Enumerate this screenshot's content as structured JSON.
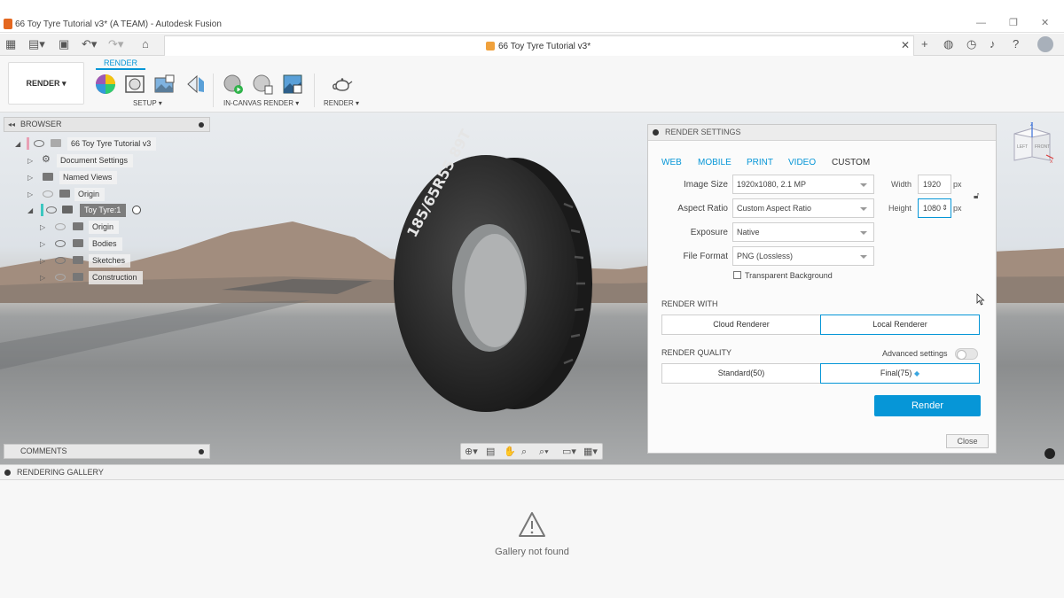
{
  "window": {
    "title": "66 Toy Tyre Tutorial v3* (A TEAM) - Autodesk Fusion",
    "minimize_icon": "minimize-icon",
    "maximize_icon": "maximize-icon",
    "close_icon": "close-icon"
  },
  "document_tab": {
    "label": "66 Toy Tyre Tutorial v3*"
  },
  "ribbon": {
    "workspace": "RENDER",
    "active_tab": "RENDER",
    "groups": {
      "setup": "SETUP",
      "in_canvas": "IN-CANVAS RENDER",
      "render": "RENDER"
    }
  },
  "browser": {
    "title": "BROWSER",
    "items": [
      {
        "label": "66 Toy Tyre Tutorial v3"
      },
      {
        "label": "Document Settings"
      },
      {
        "label": "Named Views"
      },
      {
        "label": "Origin"
      },
      {
        "label": "Toy Tyre:1"
      },
      {
        "label": "Origin"
      },
      {
        "label": "Bodies"
      },
      {
        "label": "Sketches"
      },
      {
        "label": "Construction"
      }
    ]
  },
  "tyre_text": "185/65R55 89T",
  "comments": {
    "title": "COMMENTS"
  },
  "render_settings": {
    "title": "RENDER SETTINGS",
    "presets": [
      "WEB",
      "MOBILE",
      "PRINT",
      "VIDEO",
      "CUSTOM"
    ],
    "active_preset": "CUSTOM",
    "image_size": {
      "label": "Image Size",
      "value": "1920x1080, 2.1 MP"
    },
    "aspect_ratio": {
      "label": "Aspect Ratio",
      "value": "Custom Aspect Ratio"
    },
    "exposure": {
      "label": "Exposure",
      "value": "Native"
    },
    "file_format": {
      "label": "File Format",
      "value": "PNG (Lossless)"
    },
    "transparent_bg": {
      "label": "Transparent Background",
      "checked": false
    },
    "width": {
      "label": "Width",
      "value": "1920",
      "unit": "px"
    },
    "height": {
      "label": "Height",
      "value": "1080",
      "unit": "px"
    },
    "render_with": {
      "label": "RENDER WITH",
      "options": [
        "Cloud Renderer",
        "Local Renderer"
      ],
      "selected": "Local Renderer"
    },
    "render_quality": {
      "label": "RENDER QUALITY",
      "options": [
        "Standard(50)",
        "Final(75)"
      ],
      "selected": "Final(75)"
    },
    "advanced": {
      "label": "Advanced settings",
      "enabled": false
    },
    "render_button": "Render",
    "close_button": "Close"
  },
  "viewcube": {
    "left": "LEFT",
    "front": "FRONT",
    "z": "Z",
    "x": "X"
  },
  "gallery": {
    "title": "RENDERING GALLERY",
    "message": "Gallery not found"
  },
  "colors": {
    "accent": "#0696d7",
    "app_orange": "#e4671f"
  }
}
